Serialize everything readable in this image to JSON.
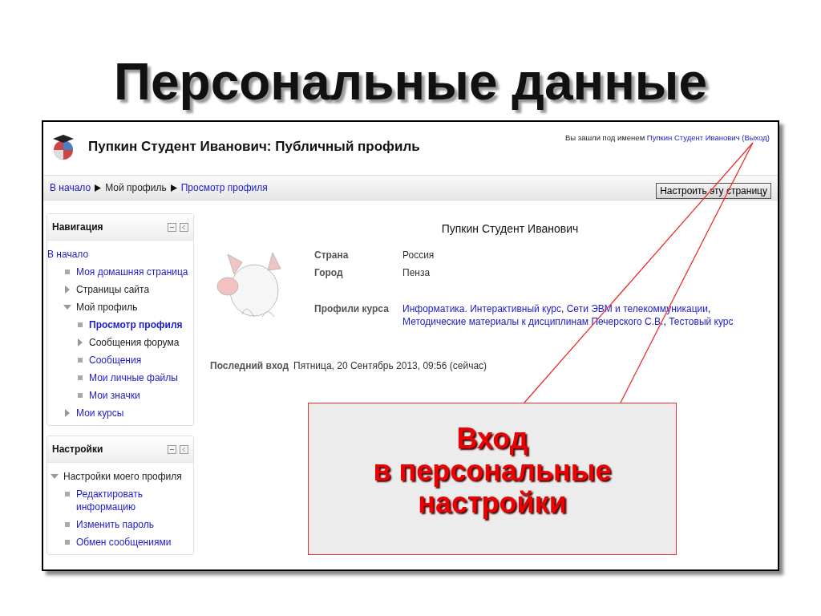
{
  "slide_title": "Персональные данные",
  "header": {
    "title": "Пупкин Студент Иванович: Публичный профиль",
    "login_prefix": "Вы зашли под именем",
    "login_user": "Пупкин Студент Иванович",
    "logout": "(Выход)"
  },
  "breadcrumbs": [
    {
      "label": "В начало",
      "link": true
    },
    {
      "label": "Мой профиль",
      "link": false
    },
    {
      "label": "Просмотр профиля",
      "link": true
    }
  ],
  "customize_button": "Настроить эту страницу",
  "blocks": [
    {
      "title": "Навигация",
      "items": [
        {
          "label": "В начало",
          "kind": "root",
          "link": true,
          "selected": false,
          "children": [
            {
              "label": "Моя домашняя страница",
              "kind": "leaf",
              "link": true,
              "selected": false
            },
            {
              "label": "Страницы сайта",
              "kind": "branch",
              "expanded": false,
              "link": false,
              "selected": false
            },
            {
              "label": "Мой профиль",
              "kind": "branch",
              "expanded": true,
              "link": false,
              "selected": false,
              "children": [
                {
                  "label": "Просмотр профиля",
                  "kind": "leaf",
                  "link": true,
                  "selected": true
                },
                {
                  "label": "Сообщения форума",
                  "kind": "branch",
                  "expanded": false,
                  "link": false,
                  "selected": false
                },
                {
                  "label": "Сообщения",
                  "kind": "leaf",
                  "link": true,
                  "selected": false
                },
                {
                  "label": "Мои личные файлы",
                  "kind": "leaf",
                  "link": true,
                  "selected": false
                },
                {
                  "label": "Мои значки",
                  "kind": "leaf",
                  "link": true,
                  "selected": false
                }
              ]
            },
            {
              "label": "Мои курсы",
              "kind": "branch",
              "expanded": false,
              "link": true,
              "selected": false
            }
          ]
        }
      ]
    },
    {
      "title": "Настройки",
      "items": [
        {
          "label": "Настройки моего профиля",
          "kind": "branch",
          "expanded": true,
          "link": false,
          "selected": false,
          "children": [
            {
              "label": "Редактировать информацию",
              "kind": "leaf",
              "link": true,
              "selected": false
            },
            {
              "label": "Изменить пароль",
              "kind": "leaf",
              "link": true,
              "selected": false
            },
            {
              "label": "Обмен сообщениями",
              "kind": "leaf",
              "link": true,
              "selected": false
            }
          ]
        }
      ]
    }
  ],
  "profile": {
    "name": "Пупкин Студент Иванович",
    "fields": [
      {
        "label": "Страна",
        "value": "Россия"
      },
      {
        "label": "Город",
        "value": "Пенза"
      }
    ],
    "courses_label": "Профили курса",
    "separator": ",",
    "courses": [
      {
        "label": "Информатика. Интерактивный курс"
      },
      {
        "label": "Сети ЭВМ и телекоммуникации"
      },
      {
        "label": "Методические материалы к дисциплинам Печерского С.В."
      },
      {
        "label": "Тестовый курс"
      }
    ],
    "last_login": {
      "label": "Последний вход",
      "value": "Пятница, 20 Сентябрь 2013, 09:56  (сейчас)"
    }
  },
  "callout": {
    "lines": [
      "Вход",
      "в персональные",
      "настройки"
    ]
  }
}
